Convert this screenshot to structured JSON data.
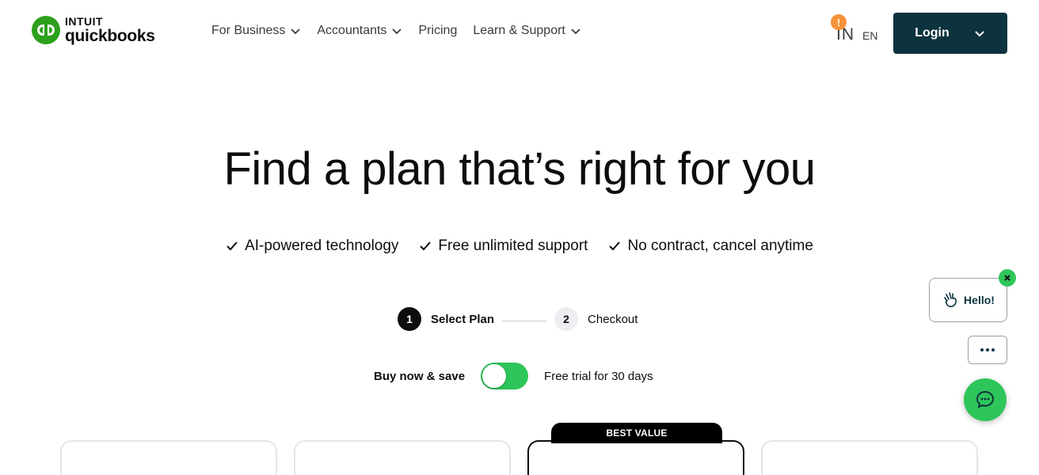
{
  "header": {
    "logo": {
      "brand_top": "INTUIT",
      "brand_bottom": "quickbooks"
    },
    "nav": [
      {
        "label": "For Business",
        "has_dropdown": true
      },
      {
        "label": "Accountants",
        "has_dropdown": true
      },
      {
        "label": "Pricing",
        "has_dropdown": false
      },
      {
        "label": "Learn & Support",
        "has_dropdown": true
      }
    ],
    "region": {
      "code": "IN",
      "language": "EN",
      "alert": "!"
    },
    "login_label": "Login"
  },
  "hero": {
    "title": "Find a plan that’s right for you",
    "benefits": [
      "AI-powered technology",
      "Free unlimited support",
      "No contract, cancel anytime"
    ]
  },
  "steps": [
    {
      "number": "1",
      "label": "Select Plan",
      "active": true
    },
    {
      "number": "2",
      "label": "Checkout",
      "active": false
    }
  ],
  "billing_toggle": {
    "left_label": "Buy now & save",
    "right_label": "Free trial for 30 days",
    "selected": "Buy now & save"
  },
  "plans": {
    "badge": "BEST VALUE"
  },
  "chat": {
    "greeting": "Hello!"
  },
  "colors": {
    "brand_green": "#2ca01c",
    "login_bg": "#0d333f",
    "toggle_green": "#2ec55a",
    "alert_orange": "#f7923a"
  }
}
